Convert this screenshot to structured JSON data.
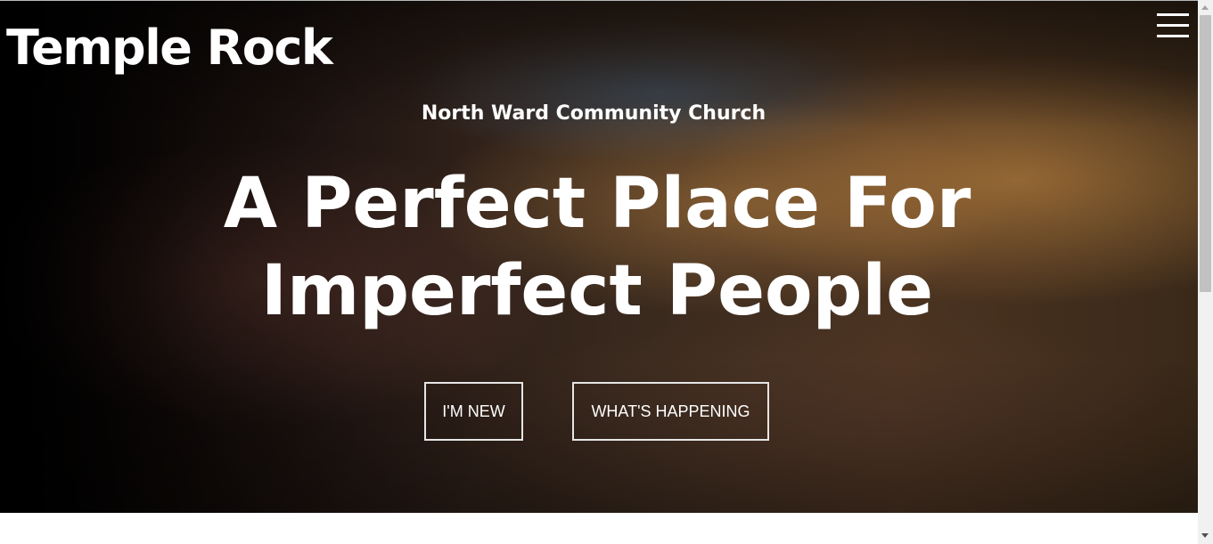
{
  "header": {
    "brand": "Temple Rock",
    "menu_icon": "hamburger-menu-icon"
  },
  "hero": {
    "subtitle": "North Ward Community Church",
    "headline_line1": "A Perfect Place For",
    "headline_line2": "Imperfect People",
    "buttons": {
      "new_label": "I'M NEW",
      "happening_label": "WHAT'S HAPPENING"
    }
  },
  "colors": {
    "text": "#ffffff",
    "button_border": "#e6e6e6",
    "scrollbar_track": "#f1f1f1",
    "scrollbar_thumb": "#c1c1c1"
  }
}
